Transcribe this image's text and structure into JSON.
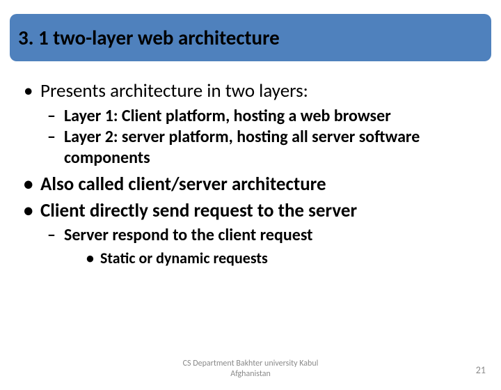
{
  "title": "3. 1 two-layer web architecture",
  "bullets": {
    "b1": "Presents architecture in two layers:",
    "b1_sub1_label": "Layer 1:",
    "b1_sub1_text": " Client platform, hosting a web browser",
    "b1_sub2_label": "Layer 2:",
    "b1_sub2_text": " server platform, hosting all server software components",
    "b2": "Also called client/server architecture",
    "b3": "Client directly send request to the server",
    "b3_sub1": "Server respond to the client request",
    "b3_sub1_sub1": "Static or dynamic requests"
  },
  "footer_line1": "CS Department Bakhter university Kabul",
  "footer_line2": "Afghanistan",
  "page_number": "21"
}
